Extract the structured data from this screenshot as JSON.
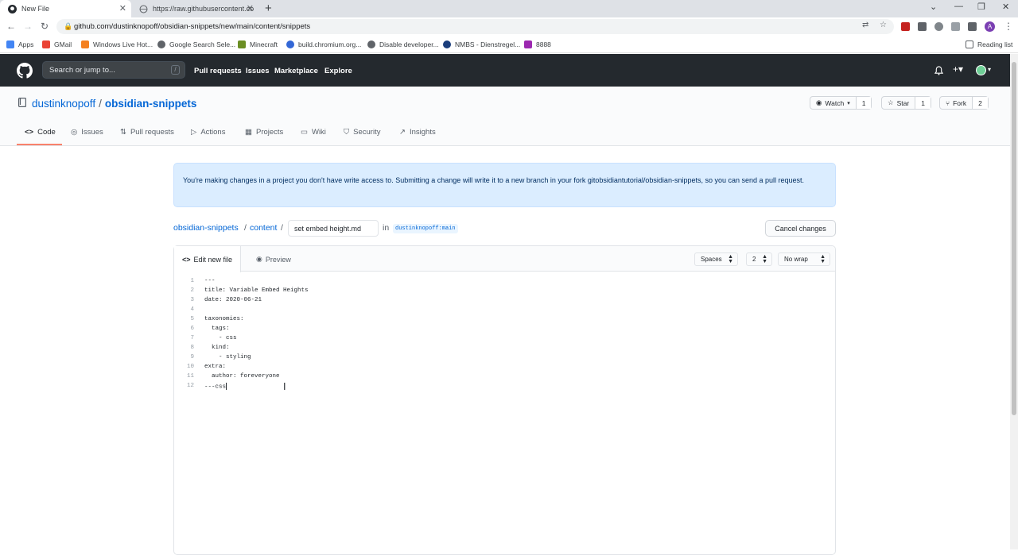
{
  "browser": {
    "tabs": [
      {
        "title": "New File",
        "active": true
      },
      {
        "title": "https://raw.githubusercontent.co",
        "active": false
      }
    ],
    "url": "github.com/dustinknopoff/obsidian-snippets/new/main/content/snippets",
    "bookmarks": [
      {
        "label": "Apps",
        "color": "#4285f4"
      },
      {
        "label": "GMail",
        "color": "#ea4335"
      },
      {
        "label": "Windows Live Hot...",
        "color": "#f4801f"
      },
      {
        "label": "Google Search Sele...",
        "color": "#5f6368"
      },
      {
        "label": "Minecraft",
        "color": "#6b8e23"
      },
      {
        "label": "build.chromium.org...",
        "color": "#3367d6"
      },
      {
        "label": "Disable developer...",
        "color": "#5f6368"
      },
      {
        "label": "NMBS - Dienstregel...",
        "color": "#1a3d7c"
      },
      {
        "label": "8888",
        "color": "#9c27b0"
      }
    ],
    "reading_list": "Reading list",
    "profile_initial": "A"
  },
  "header": {
    "search_placeholder": "Search or jump to...",
    "search_key": "/",
    "nav": [
      "Pull requests",
      "Issues",
      "Marketplace",
      "Explore"
    ]
  },
  "repo": {
    "owner": "dustinknopoff",
    "separator": "/",
    "name": "obsidian-snippets",
    "watch": {
      "label": "Watch",
      "count": "1"
    },
    "star": {
      "label": "Star",
      "count": "1"
    },
    "fork": {
      "label": "Fork",
      "count": "2"
    },
    "tabs": [
      "Code",
      "Issues",
      "Pull requests",
      "Actions",
      "Projects",
      "Wiki",
      "Security",
      "Insights"
    ]
  },
  "flash": "You're making changes in a project you don't have write access to. Submitting a change will write it to a new branch in your fork gitobsidiantutorial/obsidian-snippets, so you can send a pull request.",
  "breadcrumb": {
    "repo": "obsidian-snippets",
    "sep1": "/",
    "folder": "content",
    "sep2": "/",
    "filename": "set embed height.md",
    "in_label": "in",
    "branch": "dustinknopoff:main",
    "cancel": "Cancel changes"
  },
  "editor": {
    "tab_edit": "Edit new file",
    "tab_preview": "Preview",
    "indent_mode": "Spaces",
    "indent_size": "2",
    "wrap_mode": "No wrap",
    "lines": [
      {
        "n": "1",
        "text": "---"
      },
      {
        "n": "2",
        "text": "title: Variable Embed Heights"
      },
      {
        "n": "3",
        "text": "date: 2020-06-21"
      },
      {
        "n": "4",
        "text": ""
      },
      {
        "n": "5",
        "text": "taxonomies:"
      },
      {
        "n": "6",
        "text": "  tags:"
      },
      {
        "n": "7",
        "text": "    - css"
      },
      {
        "n": "8",
        "text": "  kind:"
      },
      {
        "n": "9",
        "text": "    - styling"
      },
      {
        "n": "10",
        "text": "extra:"
      },
      {
        "n": "11",
        "text": "  author: foreveryone"
      },
      {
        "n": "12",
        "text": "---css"
      }
    ]
  }
}
